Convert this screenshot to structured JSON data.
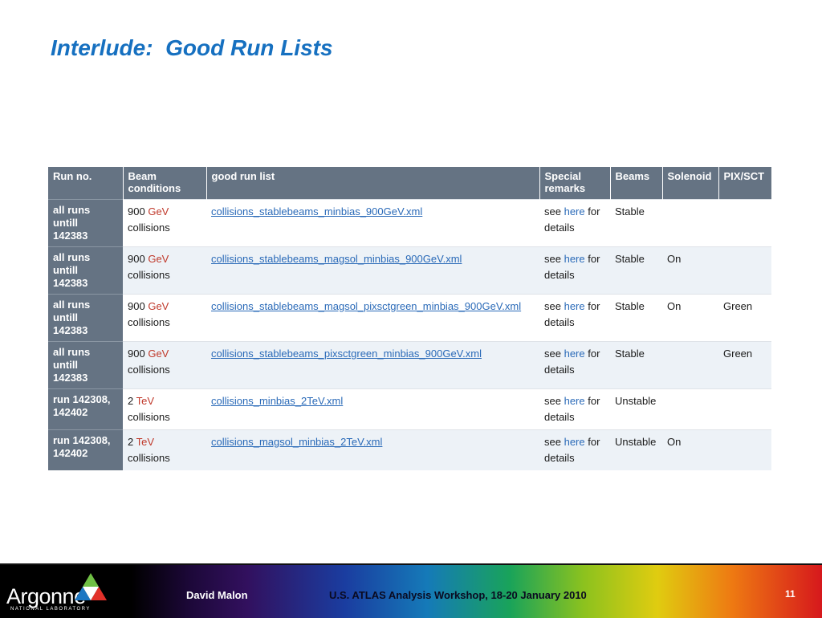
{
  "slide": {
    "title": "Interlude:  Good Run Lists"
  },
  "table": {
    "headers": [
      "Run no.",
      "Beam\nconditions",
      "good run list",
      "Special\nremarks",
      "Beams",
      "Solenoid",
      "PIX/SCT"
    ],
    "rows": [
      {
        "run": "all runs\nuntill\n142383",
        "energy": "900",
        "unit": "GeV",
        "collisions": "collisions",
        "list": "collisions_stablebeams_minbias_900GeV.xml",
        "see": "see",
        "here": "here",
        "for": "for",
        "details": "details",
        "beams": "Stable",
        "solenoid": "",
        "pixsct": ""
      },
      {
        "run": "all runs\nuntill\n142383",
        "energy": "900",
        "unit": "GeV",
        "collisions": "collisions",
        "list": "collisions_stablebeams_magsol_minbias_900GeV.xml",
        "see": "see",
        "here": "here",
        "for": "for",
        "details": "details",
        "beams": "Stable",
        "solenoid": "On",
        "pixsct": ""
      },
      {
        "run": "all runs\nuntill\n142383",
        "energy": "900",
        "unit": "GeV",
        "collisions": "collisions",
        "list": "collisions_stablebeams_magsol_pixsctgreen_minbias_900GeV.xml",
        "see": "see",
        "here": "here",
        "for": "for",
        "details": "details",
        "beams": "Stable",
        "solenoid": "On",
        "pixsct": "Green"
      },
      {
        "run": "all runs\nuntill\n142383",
        "energy": "900",
        "unit": "GeV",
        "collisions": "collisions",
        "list": "collisions_stablebeams_pixsctgreen_minbias_900GeV.xml",
        "see": "see",
        "here": "here",
        "for": "for",
        "details": "details",
        "beams": "Stable",
        "solenoid": "",
        "pixsct": "Green"
      },
      {
        "run": "run 142308,\n142402",
        "energy": "2",
        "unit": "TeV",
        "collisions": "collisions",
        "list": "collisions_minbias_2TeV.xml",
        "see": "see",
        "here": "here",
        "for": "for",
        "details": "details",
        "beams": "Unstable",
        "solenoid": "",
        "pixsct": ""
      },
      {
        "run": "run 142308,\n142402",
        "energy": "2",
        "unit": "TeV",
        "collisions": "collisions",
        "list": "collisions_magsol_minbias_2TeV.xml",
        "see": "see",
        "here": "here",
        "for": "for",
        "details": "details",
        "beams": "Unstable",
        "solenoid": "On",
        "pixsct": ""
      }
    ]
  },
  "footer": {
    "logo_name": "Argonne",
    "logo_sub": "NATIONAL LABORATORY",
    "presenter": "David Malon",
    "workshop": "U.S. ATLAS Analysis Workshop, 18-20 January 2010",
    "page": "11"
  },
  "colors": {
    "title": "#1670c0",
    "header_bg": "#657383",
    "unit_text": "#c0392b",
    "link": "#2a6ab8",
    "row_alt": "#edf2f7"
  }
}
